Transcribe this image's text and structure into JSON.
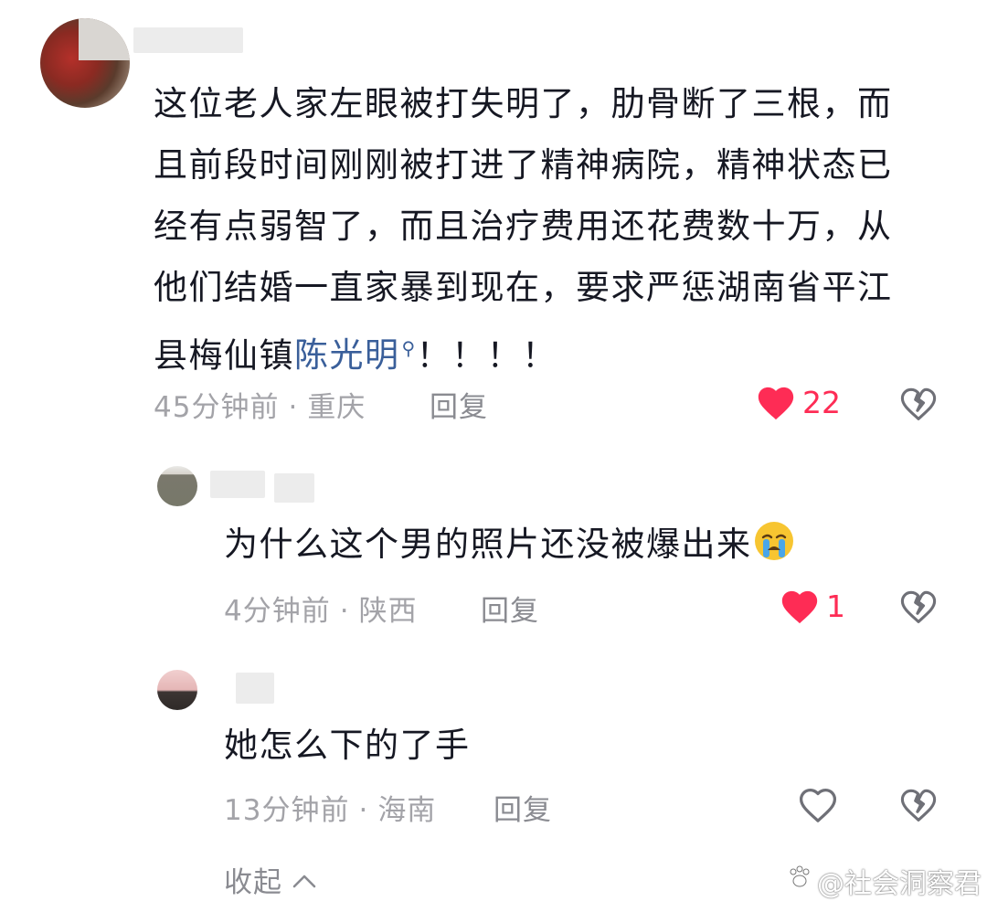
{
  "comments": [
    {
      "text_lines": [
        "这位老人家左眼被打失明了，肋骨断了三根，而",
        "且前段时间刚刚被打进了精神病院，精神状态已",
        "经有点弱智了，而且治疗费用还花费数十万，从",
        "他们结婚一直家暴到现在，要求严惩湖南省平江"
      ],
      "last_line_prefix": "县梅仙镇",
      "mention": "陈光明",
      "last_line_suffix": "！！！！",
      "time": "45分钟前",
      "location": "重庆",
      "reply_label": "回复",
      "likes": "22",
      "liked": true
    },
    {
      "text": "为什么这个男的照片还没被爆出来",
      "emoji": "loudly-crying-face",
      "time": "4分钟前",
      "location": "陕西",
      "reply_label": "回复",
      "likes": "1",
      "liked": true
    },
    {
      "text": "她怎么下的了手",
      "time": "13分钟前",
      "location": "海南",
      "reply_label": "回复",
      "likes": "",
      "liked": false
    }
  ],
  "collapse_label": "收起",
  "watermark": "@社会洞察君",
  "colors": {
    "like_red": "#fe2c55",
    "mention_blue": "#3a5f9a",
    "meta_gray": "#a3a3a8"
  }
}
